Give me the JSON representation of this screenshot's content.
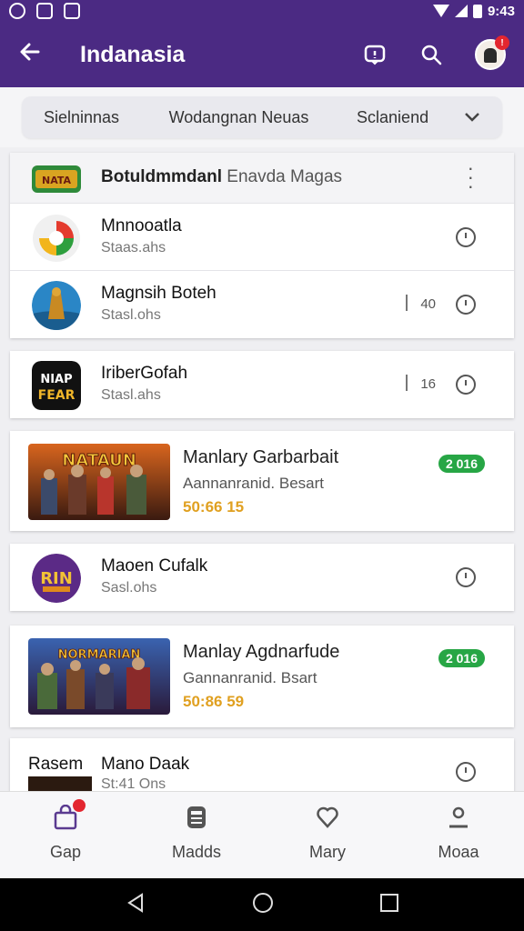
{
  "status_bar": {
    "time": "9:43"
  },
  "app_bar": {
    "title": "Indanasia"
  },
  "filters": {
    "item1": "Sielninnas",
    "item2": "Wodangnan Neuas",
    "item3": "Sclaniend"
  },
  "header_row": {
    "bold": "Botuldmmdanl",
    "light": "Enavda Magas"
  },
  "apps": [
    {
      "name": "Mnnooatla",
      "sub": "Staas.ahs"
    },
    {
      "name": "Magnsih Boteh",
      "sub": "Stasl.ohs",
      "count": "40"
    },
    {
      "name": "IriberGofah",
      "sub": "Stasl.ahs",
      "count": "16"
    }
  ],
  "promo1": {
    "title": "Manlary Garbarbait",
    "subtitle": "Aannanranid. Besart",
    "price": "50:66 15",
    "badge": "2 016",
    "art_text": "NATAUN"
  },
  "app4": {
    "name": "Maoen Cufalk",
    "sub": "Sasl.ohs",
    "art_text": "RIN"
  },
  "promo2": {
    "title": "Manlay Agdnarfude",
    "subtitle": "Gannanranid. Bsart",
    "price": "50:86 59",
    "badge": "2 016",
    "art_text": "NORMARIAN"
  },
  "app5": {
    "prefix": "Rasem",
    "name": "Mano Daak",
    "sub": "St:41 Ons"
  },
  "bottom_nav": [
    {
      "label": "Gap",
      "icon": "bag-icon"
    },
    {
      "label": "Madds",
      "icon": "calculator-icon"
    },
    {
      "label": "Mary",
      "icon": "heart-icon"
    },
    {
      "label": "Moaa",
      "icon": "person-icon"
    }
  ],
  "colors": {
    "primary": "#4b2a83",
    "badge_green": "#27a645",
    "price_gold": "#e0a020",
    "notif_red": "#e3262f"
  }
}
